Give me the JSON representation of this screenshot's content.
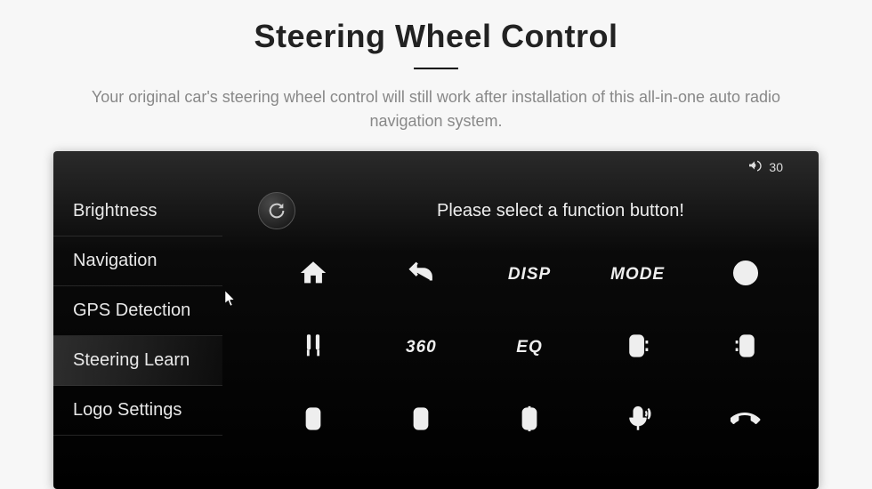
{
  "header": {
    "title": "Steering Wheel Control",
    "subtitle": "Your original car's steering wheel control will still work after installation of this all-in-one auto radio navigation system."
  },
  "statusbar": {
    "volume": "30"
  },
  "sidebar": {
    "items": [
      {
        "label": "Brightness",
        "active": false
      },
      {
        "label": "Navigation",
        "active": false
      },
      {
        "label": "GPS Detection",
        "active": false
      },
      {
        "label": "Steering Learn",
        "active": true
      },
      {
        "label": "Logo Settings",
        "active": false
      }
    ]
  },
  "content": {
    "prompt": "Please select a function button!",
    "buttons": {
      "disp": "DISP",
      "mode": "MODE",
      "threesixty": "360",
      "eq": "EQ"
    }
  }
}
